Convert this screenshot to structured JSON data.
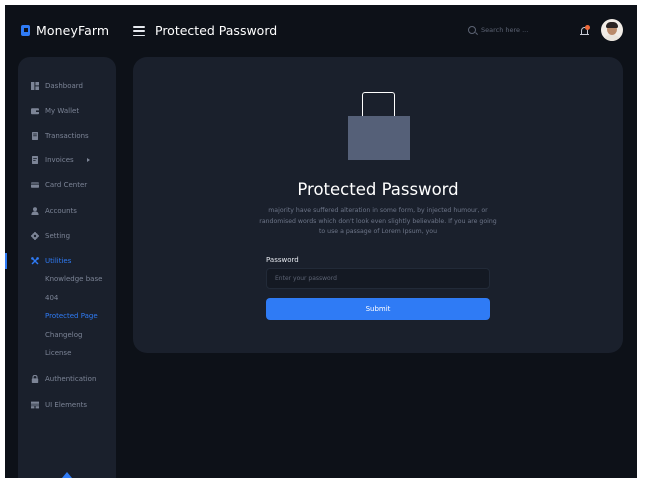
{
  "brand": {
    "name": "MoneyFarm",
    "accent_color": "#2f7bf5"
  },
  "header": {
    "page_title": "Protected Password",
    "search_placeholder": "Search here ...",
    "notification_icon": "bell-icon",
    "has_notification_dot": true
  },
  "sidebar": {
    "items": [
      {
        "label": "Dashboard",
        "icon": "dashboard-icon"
      },
      {
        "label": "My Wallet",
        "icon": "wallet-icon"
      },
      {
        "label": "Transactions",
        "icon": "receipt-icon"
      },
      {
        "label": "Invoices",
        "icon": "invoice-icon",
        "has_submenu_arrow": true
      },
      {
        "label": "Card Center",
        "icon": "credit-card-icon"
      },
      {
        "label": "Accounts",
        "icon": "user-icon"
      },
      {
        "label": "Setting",
        "icon": "gear-icon"
      },
      {
        "label": "Utilities",
        "icon": "tools-icon",
        "active": true
      },
      {
        "label": "Authentication",
        "icon": "lock-icon"
      },
      {
        "label": "UI Elements",
        "icon": "ui-elements-icon"
      }
    ],
    "utilities_submenu": [
      {
        "label": "Knowledge base"
      },
      {
        "label": "404"
      },
      {
        "label": "Protected Page",
        "active": true
      },
      {
        "label": "Changelog"
      },
      {
        "label": "License"
      }
    ]
  },
  "main": {
    "title": "Protected Password",
    "description": "majority have suffered alteration in some form, by injected humour, or randomised words which don't look even slightly believable. If you are going to use a passage of Lorem Ipsum, you",
    "password_label": "Password",
    "password_placeholder": "Enter your password",
    "password_value": "",
    "submit_label": "Submit",
    "illustration_icon": "padlock-icon"
  }
}
